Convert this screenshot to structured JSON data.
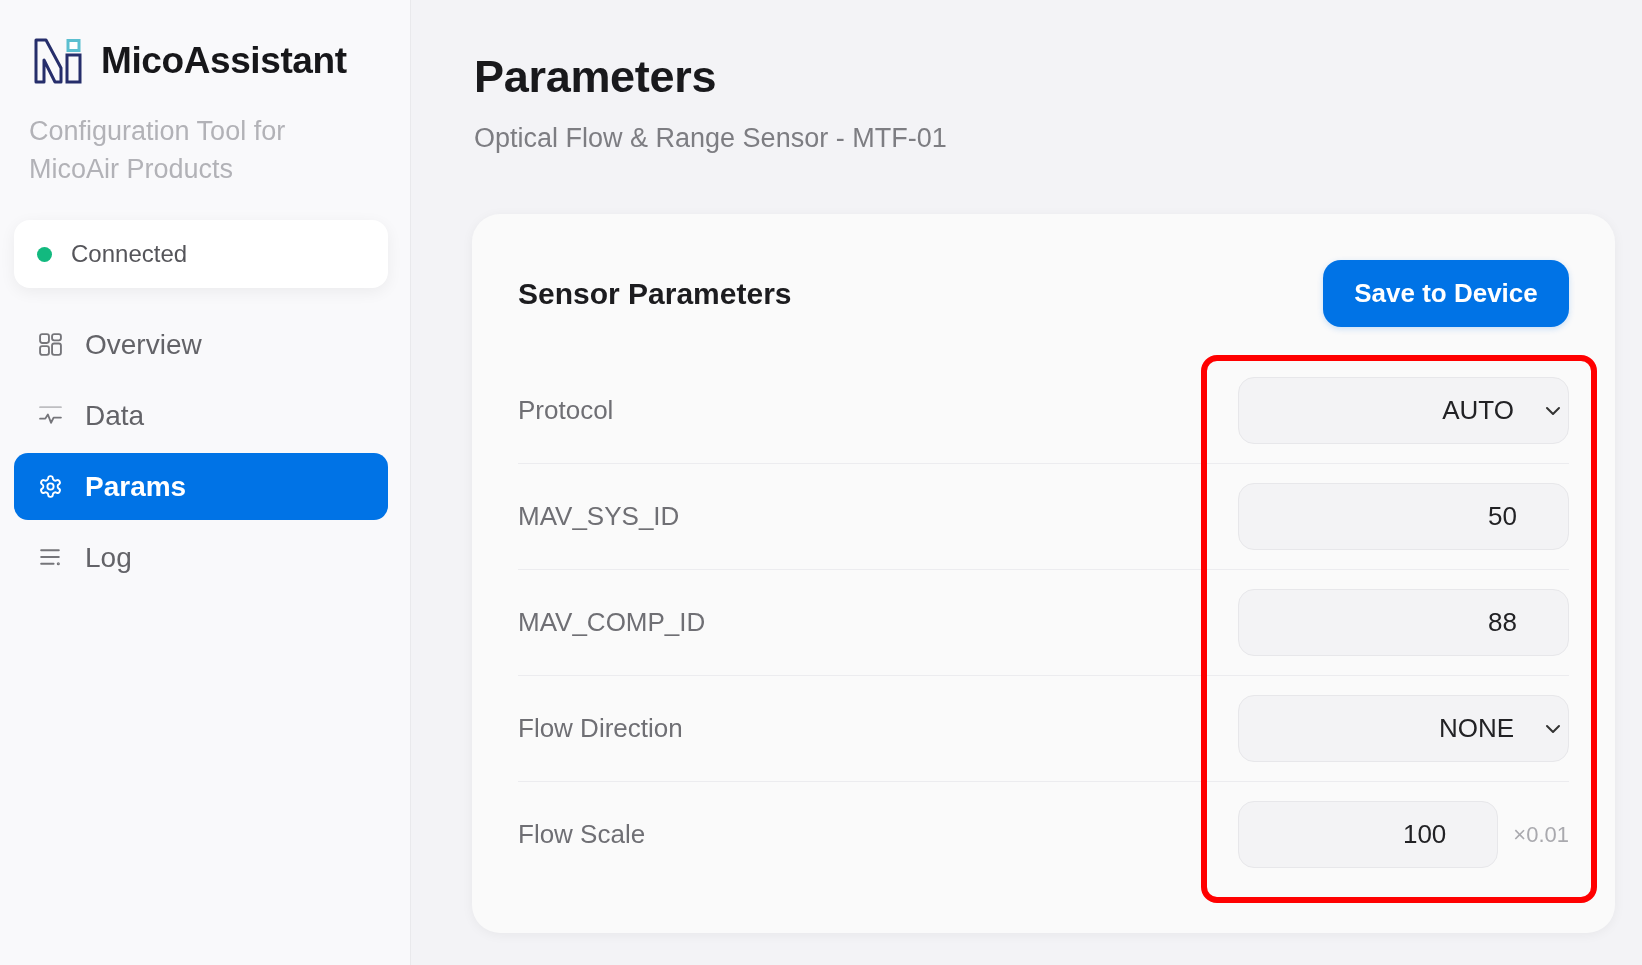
{
  "sidebar": {
    "app_name": "MicoAssistant",
    "tagline": "Configuration Tool for MicoAir Products",
    "connection": {
      "label": "Connected",
      "connected": true
    },
    "nav": [
      {
        "label": "Overview",
        "selected": false
      },
      {
        "label": "Data",
        "selected": false
      },
      {
        "label": "Params",
        "selected": true
      },
      {
        "label": "Log",
        "selected": false
      }
    ]
  },
  "page": {
    "title": "Parameters",
    "subtitle": "Optical Flow & Range Sensor - MTF-01"
  },
  "card": {
    "title": "Sensor Parameters",
    "save_button": "Save to Device",
    "highlight_frame": true,
    "params": [
      {
        "label": "Protocol",
        "kind": "select",
        "value": "AUTO"
      },
      {
        "label": "MAV_SYS_ID",
        "kind": "number",
        "value": "50"
      },
      {
        "label": "MAV_COMP_ID",
        "kind": "number",
        "value": "88"
      },
      {
        "label": "Flow Direction",
        "kind": "select",
        "value": "NONE"
      },
      {
        "label": "Flow Scale",
        "kind": "number",
        "value": "100",
        "unit": "×0.01"
      }
    ]
  }
}
